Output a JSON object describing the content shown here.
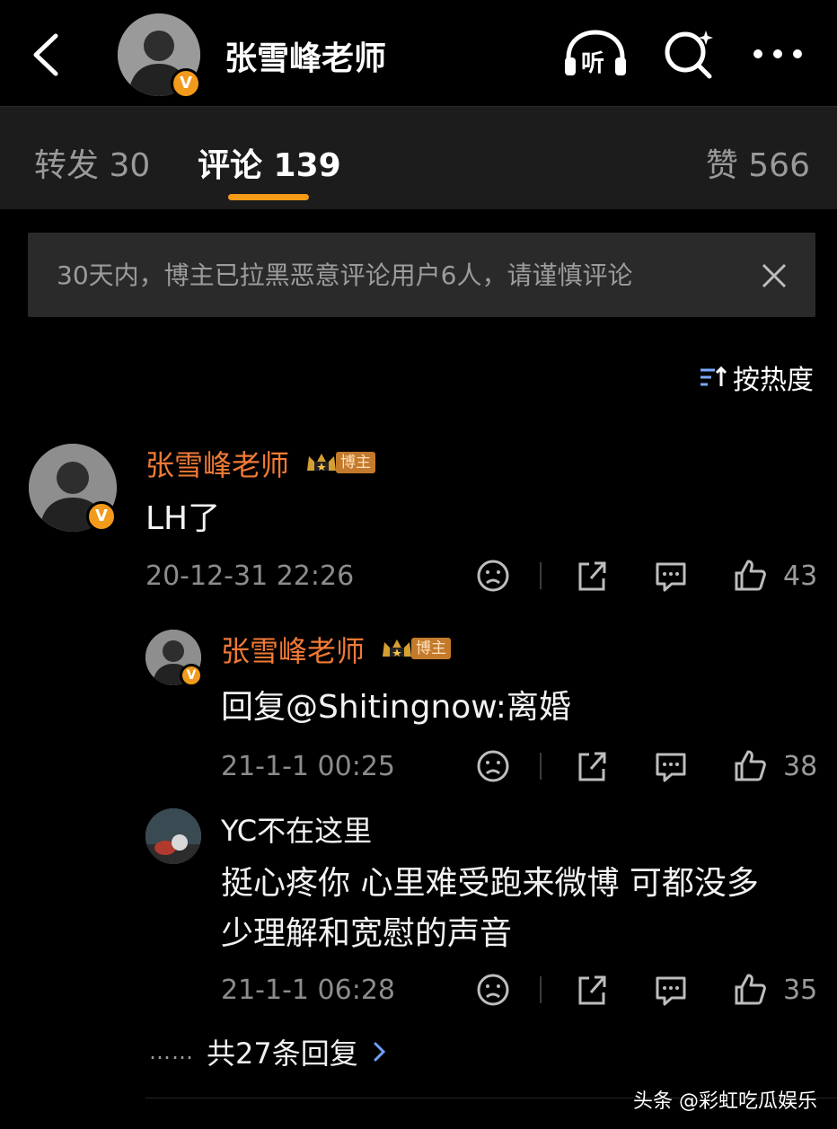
{
  "header": {
    "title": "张雪峰老师",
    "verified_badge": "V",
    "listen_label": "听"
  },
  "tabs": [
    {
      "label": "转发 30"
    },
    {
      "label": "评论 139"
    },
    {
      "label": "赞 566"
    }
  ],
  "notice": {
    "text": "30天内，博主已拉黑恶意评论用户6人，请谨慎评论"
  },
  "sort": {
    "label": "按热度"
  },
  "comments": [
    {
      "author": "张雪峰老师",
      "badge": "博主",
      "text": "LH了",
      "time": "20-12-31 22:26",
      "likes": "43"
    },
    {
      "author": "张雪峰老师",
      "badge": "博主",
      "text": "回复@Shitingnow:离婚",
      "time": "21-1-1 00:25",
      "likes": "38"
    },
    {
      "author": "YC不在这里",
      "text_line1": "挺心疼你 心里难受跑来微博 可都没多",
      "text_line2": "少理解和宽慰的声音",
      "time": "21-1-1 06:28",
      "likes": "35"
    }
  ],
  "more_replies": {
    "dots": "……",
    "label": "共27条回复"
  },
  "watermark": "头条 @彩虹吃瓜娱乐",
  "colors": {
    "accent": "#f59a17",
    "name": "#f07a35",
    "background": "#000000",
    "tabbar": "#1c1c1c",
    "notice_bg": "#2a2a2a"
  }
}
